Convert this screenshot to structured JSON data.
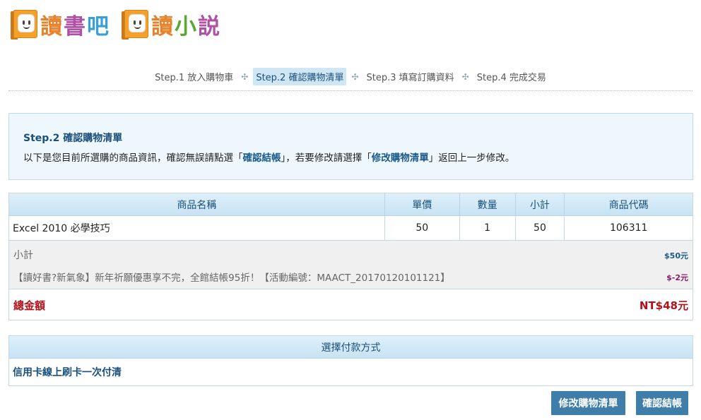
{
  "logos": [
    {
      "chars": [
        "讀",
        "書",
        "吧"
      ],
      "colors": [
        "#e8822a",
        "#b04fa6",
        "#3a9fd6"
      ]
    },
    {
      "chars": [
        "讀",
        "小",
        "説"
      ],
      "colors": [
        "#e8822a",
        "#5aa832",
        "#b04fa6"
      ]
    }
  ],
  "steps": [
    {
      "label": "Step.1 放入購物車",
      "active": false
    },
    {
      "label": "Step.2 確認購物清單",
      "active": true
    },
    {
      "label": "Step.3 填寫訂購資料",
      "active": false
    },
    {
      "label": "Step.4 完成交易",
      "active": false
    }
  ],
  "step_separator": "✣",
  "info": {
    "title": "Step.2 確認購物清單",
    "desc_before": "以下是您目前所選購的商品資訊，確認無誤請點選「",
    "confirm_link": "確認結帳",
    "desc_middle": "」，若要修改請選擇「",
    "edit_link": "修改購物清單",
    "desc_after": "」返回上一步修改。"
  },
  "table": {
    "headers": [
      "商品名稱",
      "單價",
      "數量",
      "小計",
      "商品代碼"
    ],
    "rows": [
      {
        "name": "Excel 2010 必學技巧",
        "price": "50",
        "qty": "1",
        "subtotal": "50",
        "code": "106311"
      }
    ]
  },
  "summary": {
    "subtotal_label": "小計",
    "subtotal_amount": "$50元",
    "promo_text": "【讀好書?新氣象】新年祈願優惠享不完，全館結帳95折！【活動編號：MAACT_20170120101121】",
    "promo_amount": "$-2元"
  },
  "total": {
    "label": "總金額",
    "amount": "NT$48元"
  },
  "payment": {
    "header": "選擇付款方式",
    "method": "信用卡線上刷卡一次付清"
  },
  "buttons": {
    "edit": "修改購物清單",
    "confirm": "確認結帳"
  }
}
